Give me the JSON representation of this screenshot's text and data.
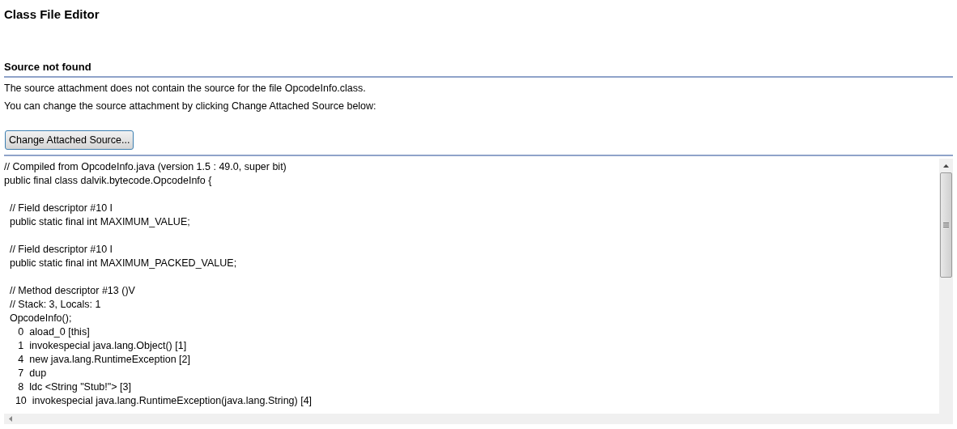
{
  "editor": {
    "title": "Class File Editor"
  },
  "notice": {
    "heading": "Source not found",
    "messages": [
      "The source attachment does not contain the source for the file OpcodeInfo.class.",
      "You can change the source attachment by clicking Change Attached Source below:"
    ],
    "button": "Change Attached Source..."
  },
  "code": {
    "blocks": [
      [
        "// Compiled from OpcodeInfo.java (version 1.5 : 49.0, super bit)",
        "public final class dalvik.bytecode.OpcodeInfo {"
      ],
      [
        "  // Field descriptor #10 I",
        "  public static final int MAXIMUM_VALUE;"
      ],
      [
        "  // Field descriptor #10 I",
        "  public static final int MAXIMUM_PACKED_VALUE;"
      ],
      [
        "  // Method descriptor #13 ()V",
        "  // Stack: 3, Locals: 1",
        "  OpcodeInfo();",
        "     0  aload_0 [this]",
        "     1  invokespecial java.lang.Object() [1]",
        "     4  new java.lang.RuntimeException [2]",
        "     7  dup",
        "     8  ldc <String \"Stub!\"> [3]",
        "    10  invokespecial java.lang.RuntimeException(java.lang.String) [4]"
      ]
    ]
  }
}
